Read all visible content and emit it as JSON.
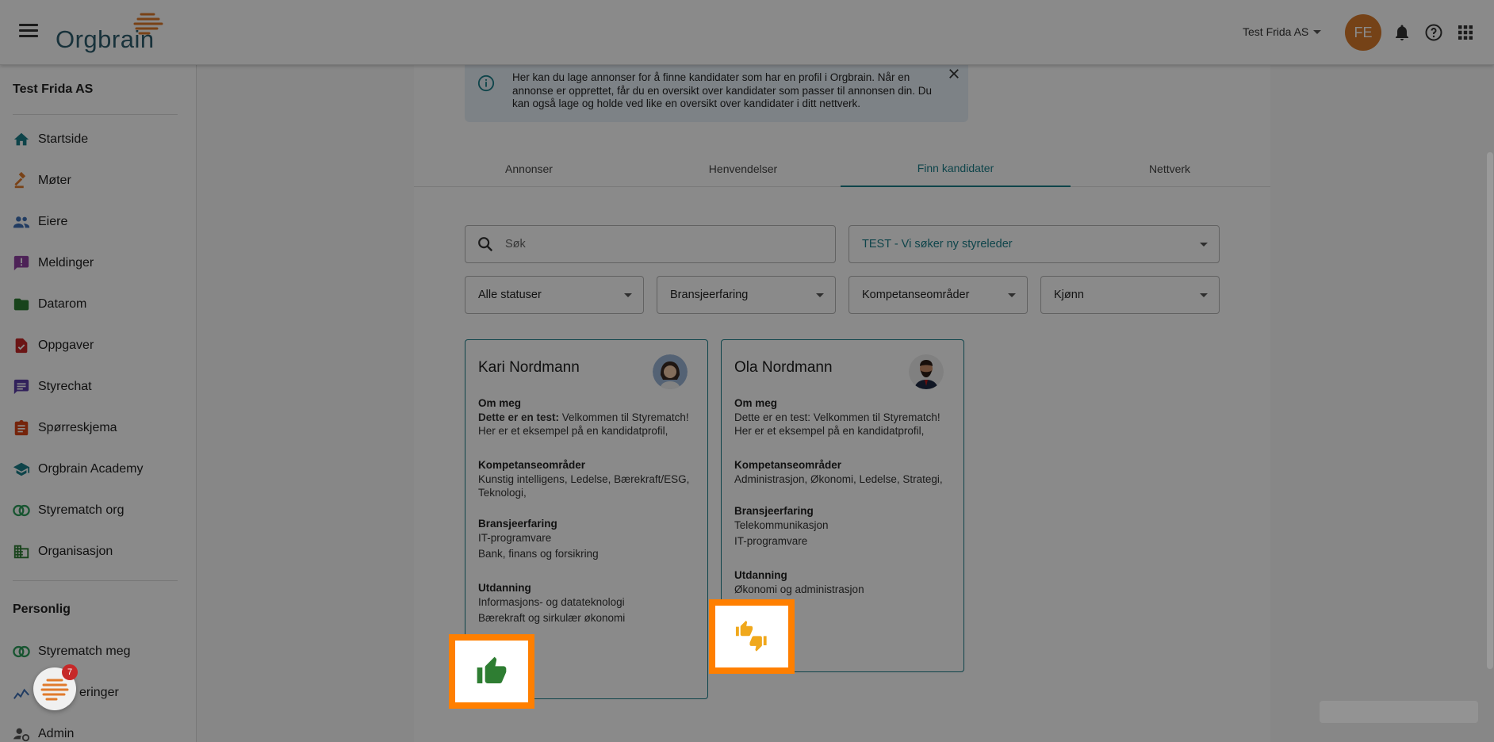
{
  "app": {
    "logo_text": "Orgbrain",
    "company_selector": "Test Frida AS",
    "user_initials": "FE"
  },
  "sidebar": {
    "company": "Test Frida AS",
    "items": [
      {
        "label": "Startside",
        "icon": "home-icon",
        "color": "#1b7f8a"
      },
      {
        "label": "Møter",
        "icon": "gavel-icon",
        "color": "#e07a2c"
      },
      {
        "label": "Eiere",
        "icon": "people-icon",
        "color": "#3d6fb6"
      },
      {
        "label": "Meldinger",
        "icon": "message-alert-icon",
        "color": "#8e3fa1"
      },
      {
        "label": "Datarom",
        "icon": "folder-icon",
        "color": "#2e7d32"
      },
      {
        "label": "Oppgaver",
        "icon": "task-icon",
        "color": "#c62828"
      },
      {
        "label": "Styrechat",
        "icon": "chat-icon",
        "color": "#5c3ea8"
      },
      {
        "label": "Spørreskjema",
        "icon": "clipboard-icon",
        "color": "#d84315"
      },
      {
        "label": "Orgbrain Academy",
        "icon": "school-icon",
        "color": "#1b7f8a"
      },
      {
        "label": "Styrematch org",
        "icon": "styrematch-icon",
        "color": "#2e9e5b"
      },
      {
        "label": "Organisasjon",
        "icon": "organization-icon",
        "color": "#2e7d32"
      }
    ],
    "personal_title": "Personlig",
    "personal_items": [
      {
        "label": "Styrematch meg",
        "icon": "styrematch-icon"
      },
      {
        "label": "eringer",
        "icon": "chart-icon"
      },
      {
        "label": "Admin",
        "icon": "admin-icon"
      }
    ]
  },
  "info": {
    "text": "Her kan du lage annonser for å finne kandidater som har en profil i Orgbrain. Når en annonse er opprettet, får du en oversikt over kandidater som passer til annonsen din. Du kan også lage og holde ved like en oversikt over kandidater i ditt nettverk."
  },
  "tabs": [
    {
      "label": "Annonser",
      "active": false
    },
    {
      "label": "Henvendelser",
      "active": false
    },
    {
      "label": "Finn kandidater",
      "active": true
    },
    {
      "label": "Nettverk",
      "active": false
    }
  ],
  "filters": {
    "search_placeholder": "Søk",
    "announcement": "TEST - Vi søker ny styreleder",
    "status": "Alle statuser",
    "industry": "Bransjeerfaring",
    "competence": "Kompetanseområder",
    "gender": "Kjønn"
  },
  "candidates": [
    {
      "name": "Kari Nordmann",
      "about_title": "Om meg",
      "about_bold": "Dette er en test:",
      "about_text": " Velkommen til Styrematch! Her er et eksempel på en kandidatprofil,",
      "competence_title": "Kompetanseområder",
      "competence": "Kunstig intelligens, Ledelse, Bærekraft/ESG, Teknologi,",
      "industry_title": "Bransjeerfaring",
      "industry": [
        "IT-programvare",
        "Bank, finans og forsikring"
      ],
      "education_title": "Utdanning",
      "education": [
        "Informasjons- og datateknologi",
        "Bærekraft og sirkulær økonomi"
      ],
      "rating": "thumbs-up-icon"
    },
    {
      "name": "Ola Nordmann",
      "about_title": "Om meg",
      "about_bold": "",
      "about_text": "Dette er en test: Velkommen til Styrematch! Her er et eksempel på en kandidatprofil,",
      "competence_title": "Kompetanseområder",
      "competence": "Administrasjon, Økonomi, Ledelse, Strategi,",
      "industry_title": "Bransjeerfaring",
      "industry": [
        "Telekommunikasjon",
        "IT-programvare"
      ],
      "education_title": "Utdanning",
      "education": [
        "Økonomi og administrasjon"
      ],
      "rating": "thumbs-mixed-icon"
    }
  ],
  "chat_badge": "7",
  "colors": {
    "accent": "#1b7f8a",
    "highlight": "#ff7f00",
    "thumb_up": "#2e7d32",
    "thumb_mixed": "#f0a81c"
  }
}
